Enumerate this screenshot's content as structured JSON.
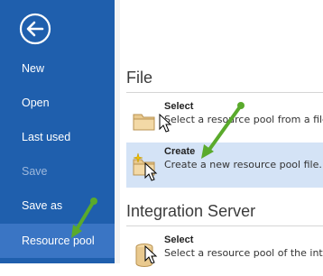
{
  "sidebar": {
    "items": [
      {
        "label": "New",
        "state": "normal"
      },
      {
        "label": "Open",
        "state": "normal"
      },
      {
        "label": "Last used",
        "state": "normal"
      },
      {
        "label": "Save",
        "state": "disabled"
      },
      {
        "label": "Save as",
        "state": "normal"
      },
      {
        "label": "Resource pool",
        "state": "active"
      }
    ],
    "back_icon": "back-arrow-icon"
  },
  "sections": {
    "file": {
      "title": "File",
      "items": [
        {
          "title": "Select",
          "desc": "Select a resource pool from a file.",
          "icon": "folder-icon"
        },
        {
          "title": "Create",
          "desc": "Create a new resource pool file.",
          "icon": "new-folder-icon"
        }
      ]
    },
    "integration": {
      "title": "Integration Server",
      "items": [
        {
          "title": "Select",
          "desc": "Select a resource pool of the integ",
          "icon": "database-icon"
        }
      ]
    }
  },
  "colors": {
    "sidebar_bg": "#1f5fad",
    "sidebar_active": "#3a75c4",
    "highlight": "#d4e3f6",
    "annotation_arrow": "#5aaa2c"
  }
}
